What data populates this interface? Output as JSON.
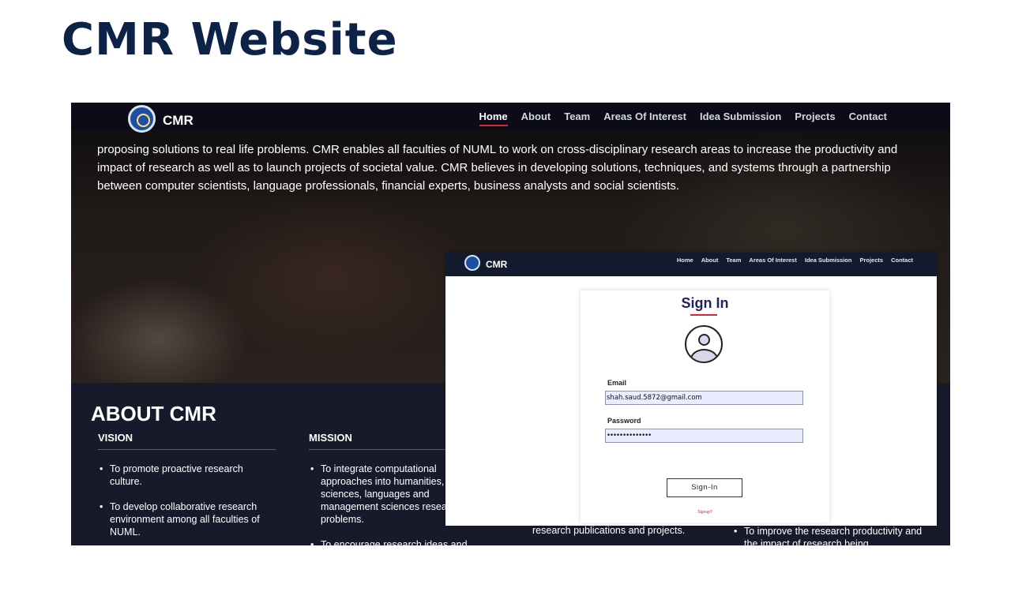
{
  "slide": {
    "title": "CMR Website"
  },
  "site": {
    "brand": "CMR",
    "nav": [
      "Home",
      "About",
      "Team",
      "Areas Of Interest",
      "Idea Submission",
      "Projects",
      "Contact"
    ],
    "active_nav": "Home",
    "hero_text": "proposing solutions to real life problems. CMR enables all faculties of NUML to work on cross-disciplinary research areas to increase the productivity and impact of research as well as to launch projects of societal value. CMR believes in developing solutions, techniques, and systems through a partnership between computer scientists, language professionals, financial experts, business analysts and social scientists.",
    "about_title": "ABOUT CMR",
    "vision": {
      "heading": "VISION",
      "items": [
        "To promote proactive research culture.",
        "To develop collaborative research environment among all faculties of NUML."
      ]
    },
    "mission": {
      "heading": "MISSION",
      "items": [
        "To integrate computational approaches into humanities, social sciences, languages and management sciences research problems.",
        "To encourage research ideas and projects of indigenous utility and"
      ]
    },
    "col3_text": "research publications and projects.",
    "col4_text": "To improve the research productivity and the impact of research being"
  },
  "signin": {
    "brand": "CMR",
    "nav": [
      "Home",
      "About",
      "Team",
      "Areas Of Interest",
      "Idea Submission",
      "Projects",
      "Contact"
    ],
    "title": "Sign In",
    "email_label": "Email",
    "email_value": "shah.saud.5872@gmail.com",
    "password_label": "Password",
    "password_value": "••••••••••••••",
    "button_label": "Sign-In",
    "signup_label": "Signup?"
  },
  "colors": {
    "navy": "#0c2347",
    "accent_red": "#e0203a",
    "nav_bg": "#141a2e"
  }
}
